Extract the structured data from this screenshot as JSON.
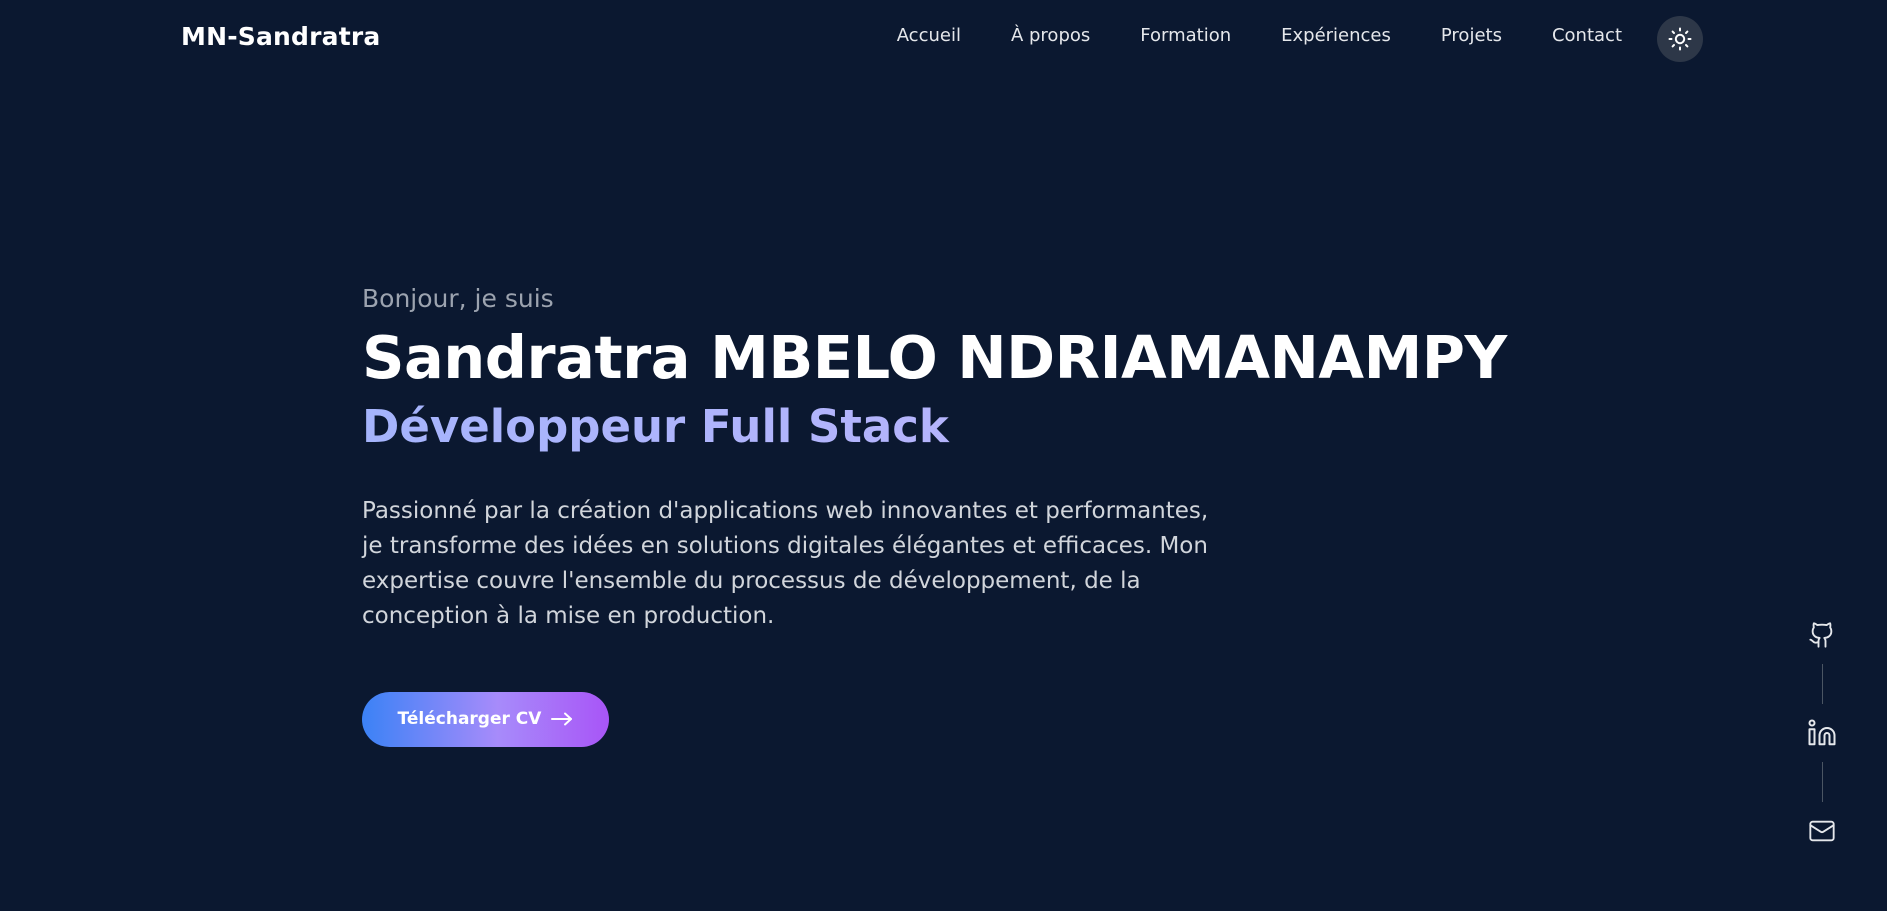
{
  "header": {
    "brand": "MN-Sandratra",
    "nav": [
      {
        "label": "Accueil"
      },
      {
        "label": "À propos"
      },
      {
        "label": "Formation"
      },
      {
        "label": "Expériences"
      },
      {
        "label": "Projets"
      },
      {
        "label": "Contact"
      }
    ],
    "theme_toggle_icon": "sun-icon"
  },
  "hero": {
    "greeting": "Bonjour, je suis",
    "name": "Sandratra MBELO NDRIAMANAMPY",
    "role": "Développeur Full Stack",
    "description": "Passionné par la création d'applications web innovantes et performantes, je transforme des idées en solutions digitales élégantes et efficaces. Mon expertise couvre l'ensemble du processus de développement, de la conception à la mise en production.",
    "cta_label": "Télécharger CV",
    "cta_icon": "arrow-right-icon"
  },
  "social": [
    {
      "icon": "github-icon"
    },
    {
      "icon": "linkedin-icon"
    },
    {
      "icon": "mail-icon"
    }
  ],
  "colors": {
    "background": "#0b1830",
    "role_gradient_start": "#a5b4fc",
    "role_gradient_end": "#c4b5fd",
    "button_gradient_start": "#3b82f6",
    "button_gradient_end": "#a855f7",
    "toggle_bg": "#2d3748"
  }
}
